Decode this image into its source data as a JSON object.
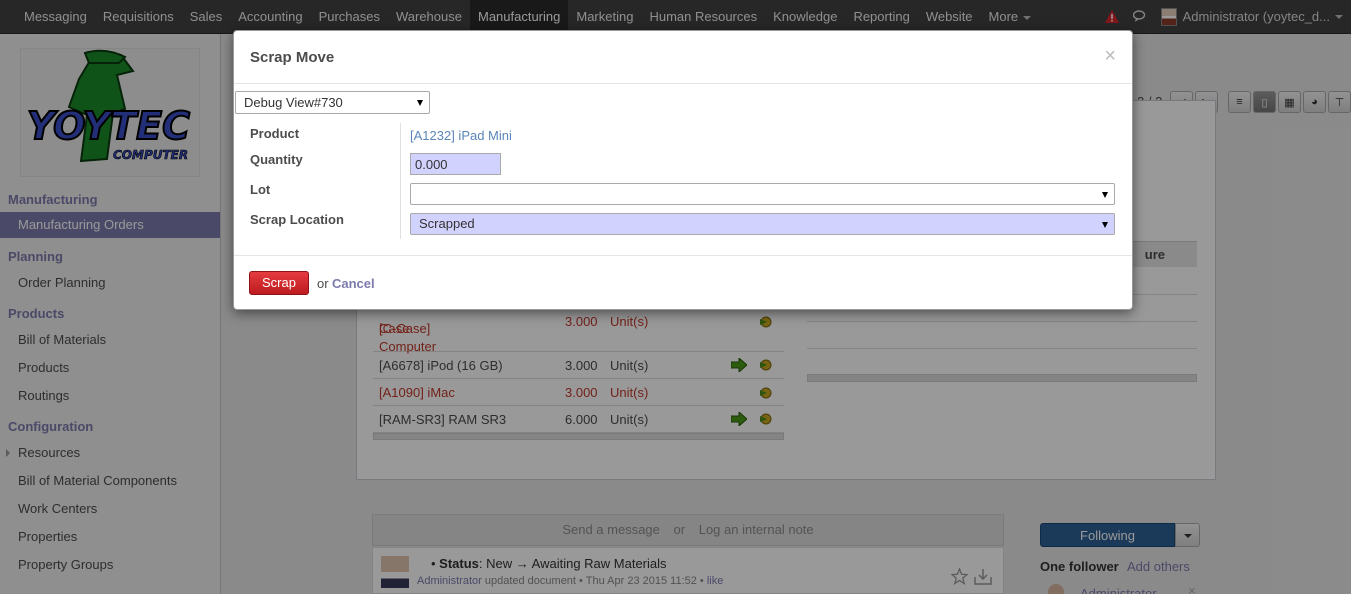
{
  "topnav": {
    "items": [
      "Messaging",
      "Requisitions",
      "Sales",
      "Accounting",
      "Purchases",
      "Warehouse",
      "Manufacturing",
      "Marketing",
      "Human Resources",
      "Knowledge",
      "Reporting",
      "Website",
      "More"
    ],
    "active": "Manufacturing",
    "user": "Administrator (yoytec_d..."
  },
  "sidebar": {
    "logo_text": "YOYTEC COMPUTER",
    "manufacturing": "Manufacturing",
    "manufacturing_orders": "Manufacturing Orders",
    "planning": "Planning",
    "order_planning": "Order Planning",
    "products_section": "Products",
    "bill_of_materials": "Bill of Materials",
    "products": "Products",
    "routings": "Routings",
    "configuration": "Configuration",
    "resources": "Resources",
    "bom_components": "Bill of Material Components",
    "work_centers": "Work Centers",
    "properties": "Properties",
    "property_groups": "Property Groups"
  },
  "background": {
    "pager": "2 / 2",
    "column_partial": "ure",
    "lines": [
      {
        "product": "[C-Case] Computer",
        "product2": "Case",
        "qty": "3.000",
        "uom": "Unit(s)",
        "red": true
      },
      {
        "product": "[A6678] iPod (16 GB)",
        "qty": "3.000",
        "uom": "Unit(s)",
        "red": false
      },
      {
        "product": "[A1090] iMac",
        "qty": "3.000",
        "uom": "Unit(s)",
        "red": true
      },
      {
        "product": "[RAM-SR3] RAM SR3",
        "qty": "6.000",
        "uom": "Unit(s)",
        "red": false
      }
    ],
    "chatter_send": "Send a message",
    "chatter_or": "or",
    "chatter_note": "Log an internal note",
    "following": "Following",
    "one_follower": "One follower",
    "add_others": "Add others",
    "msg_status_label": "Status",
    "msg_status": ": New → Awaiting Raw Materials",
    "msg_author": "Administrator",
    "msg_meta": "updated document • Thu Apr 23 2015 11:52 •",
    "msg_like": "like",
    "follower_name": "Administrator"
  },
  "modal": {
    "title": "Scrap Move",
    "close": "×",
    "debug_view": "Debug View#730",
    "product_label": "Product",
    "product_value": "[A1232] iPad Mini",
    "quantity_label": "Quantity",
    "quantity_value": "0.000",
    "lot_label": "Lot",
    "lot_value": "",
    "scrap_location_label": "Scrap Location",
    "scrap_location_value": "Scrapped",
    "scrap_button": "Scrap",
    "or": "or",
    "cancel": "Cancel"
  },
  "colors": {
    "topbar": "#414141",
    "sidebar_accent": "#7c7bad",
    "scrap_button": "#d9252a",
    "required_field": "#d2d2ff",
    "link": "#5a86b8"
  }
}
